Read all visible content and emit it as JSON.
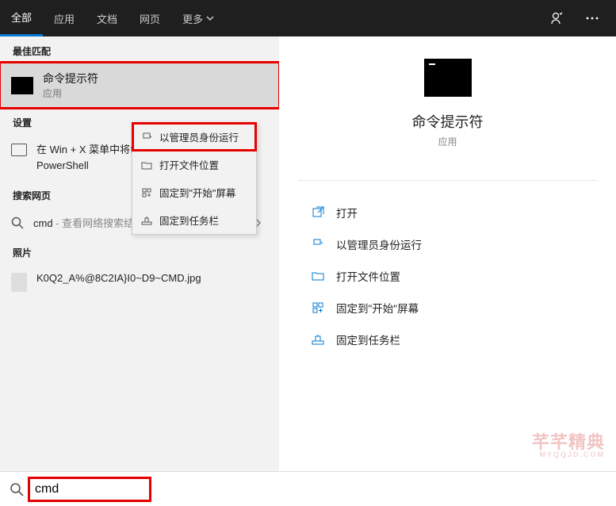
{
  "topbar": {
    "tabs": [
      "全部",
      "应用",
      "文档",
      "网页"
    ],
    "more": "更多"
  },
  "left": {
    "best_match_label": "最佳匹配",
    "best_match": {
      "title": "命令提示符",
      "subtitle": "应用"
    },
    "settings_label": "设置",
    "settings_item": "在 Win + X 菜单中将命令提示符替换为 Windows PowerShell",
    "web_label": "搜索网页",
    "web_item": {
      "query": "cmd",
      "desc": " - 查看网络搜索结果"
    },
    "photos_label": "照片",
    "photo_item": "K0Q2_A%@8C2IA}I0~D9~CMD.jpg"
  },
  "context_menu": {
    "run_admin": "以管理员身份运行",
    "open_location": "打开文件位置",
    "pin_start": "固定到\"开始\"屏幕",
    "pin_taskbar": "固定到任务栏"
  },
  "right": {
    "title": "命令提示符",
    "subtitle": "应用",
    "actions": {
      "open": "打开",
      "run_admin": "以管理员身份运行",
      "open_location": "打开文件位置",
      "pin_start": "固定到\"开始\"屏幕",
      "pin_taskbar": "固定到任务栏"
    }
  },
  "watermark": {
    "main": "芊芊精典",
    "sub": "MYQQJD.COM"
  },
  "search": {
    "value": "cmd"
  }
}
